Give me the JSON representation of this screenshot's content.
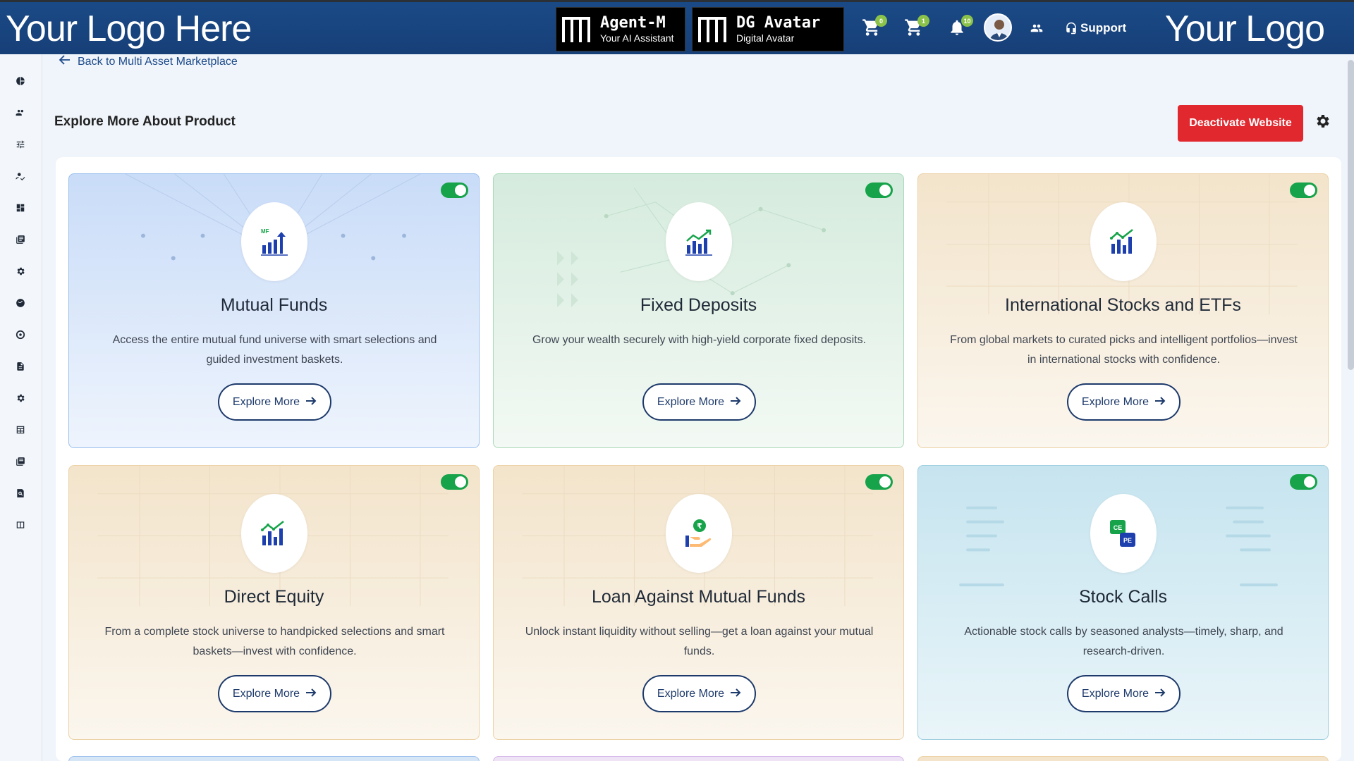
{
  "header": {
    "logo_left": "Your Logo Here",
    "logo_right": "Your Logo",
    "promos": [
      {
        "title": "Agent-M",
        "subtitle": "Your AI Assistant"
      },
      {
        "title": "DG Avatar",
        "subtitle": "Digital Avatar"
      }
    ],
    "cart_badge_1": "0",
    "cart_badge_2": "1",
    "notification_badge": "10",
    "support_label": "Support"
  },
  "back_link": "Back to Multi Asset Marketplace",
  "page_title": "Explore More About Product",
  "deactivate_label": "Deactivate Website",
  "explore_label": "Explore More",
  "cards": [
    {
      "title": "Mutual Funds",
      "description": "Access the entire mutual fund universe with smart selections and guided investment baskets.",
      "enabled": true,
      "icon": "mutual-funds-chart-icon",
      "icon_text": "MF"
    },
    {
      "title": "Fixed Deposits",
      "description": "Grow your wealth securely with high-yield corporate fixed deposits.",
      "enabled": true,
      "icon": "growth-chart-icon"
    },
    {
      "title": "International Stocks and ETFs",
      "description": "From global markets to curated picks and intelligent portfolios—invest in international stocks with confidence.",
      "enabled": true,
      "icon": "stocks-chart-icon"
    },
    {
      "title": "Direct Equity",
      "description": "From a complete stock universe to handpicked selections and smart baskets—invest with confidence.",
      "enabled": true,
      "icon": "equity-chart-icon"
    },
    {
      "title": "Loan Against Mutual Funds",
      "description": "Unlock instant liquidity without selling—get a loan against your mutual funds.",
      "enabled": true,
      "icon": "rupee-hand-icon",
      "icon_text": "₹"
    },
    {
      "title": "Stock Calls",
      "description": "Actionable stock calls by seasoned analysts—timely, sharp, and research-driven.",
      "enabled": true,
      "icon": "ce-pe-icon",
      "icon_text_1": "CE",
      "icon_text_2": "PE"
    }
  ],
  "colors": {
    "header_bg": "#173f78",
    "deactivate_bg": "#e0282e",
    "toggle_on": "#16a34a",
    "button_border": "#1d3a6b"
  }
}
